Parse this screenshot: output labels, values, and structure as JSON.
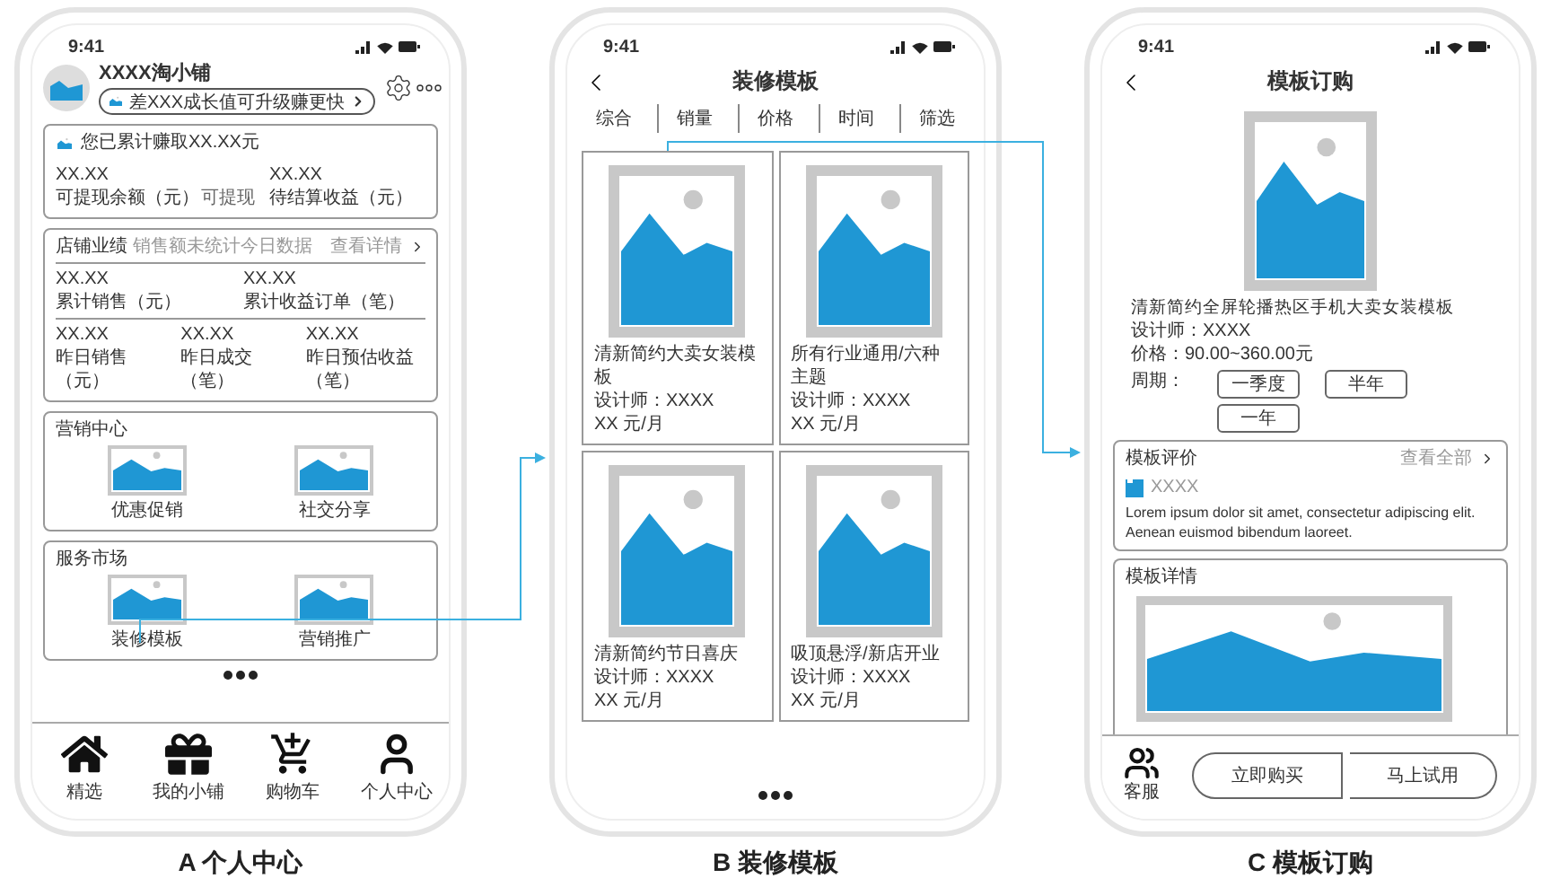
{
  "phones": [
    {
      "kind": "profile",
      "caption": "A 个人中心",
      "time": "9:41",
      "shop_name": "XXXX淘小铺",
      "upgrade_hint": "差XXX成长值可升级赚更快",
      "earnings": {
        "title": "您已累计赚取XX.XX元",
        "items": [
          {
            "value": "XX.XX",
            "label": "可提现余额（元）",
            "note": "可提现"
          },
          {
            "value": "XX.XX",
            "label": "待结算收益（元）"
          }
        ]
      },
      "performance": {
        "title": "店铺业绩",
        "subtitle": "销售额未统计今日数据",
        "link": "查看详情",
        "rows": [
          [
            {
              "value": "XX.XX",
              "label": "累计销售（元）"
            },
            {
              "value": "XX.XX",
              "label": "累计收益订单（笔）"
            }
          ],
          [
            {
              "value": "XX.XX",
              "label": "昨日销售（元）"
            },
            {
              "value": "XX.XX",
              "label": "昨日成交（笔）"
            },
            {
              "value": "XX.XX",
              "label": "昨日预估收益（笔）"
            }
          ]
        ]
      },
      "sections": [
        {
          "title": "营销中心",
          "items": [
            "优惠促销",
            "社交分享"
          ]
        },
        {
          "title": "服务市场",
          "items": [
            "装修模板",
            "营销推广"
          ]
        }
      ],
      "tabs": [
        "精选",
        "我的小铺",
        "购物车",
        "个人中心"
      ]
    },
    {
      "kind": "catalog",
      "caption": "B 装修模板",
      "time": "9:41",
      "title": "装修模板",
      "filters": [
        "综合",
        "销量",
        "价格",
        "时间",
        "筛选"
      ],
      "products": [
        {
          "name": "清新简约大卖女装模板",
          "designer": "设计师：XXXX",
          "price": "XX 元/月"
        },
        {
          "name": "所有行业通用/六种主题",
          "designer": "设计师：XXXX",
          "price": "XX 元/月"
        },
        {
          "name": "清新简约节日喜庆",
          "designer": "设计师：XXXX",
          "price": "XX 元/月"
        },
        {
          "name": "吸顶悬浮/新店开业",
          "designer": "设计师：XXXX",
          "price": "XX 元/月"
        }
      ]
    },
    {
      "kind": "order",
      "caption": "C 模板订购",
      "time": "9:41",
      "title": "模板订购",
      "product": {
        "name": "清新简约全屏轮播热区手机大卖女装模板",
        "designer": "设计师：XXXX",
        "price": "价格：90.00~360.00元"
      },
      "period": {
        "label": "周期：",
        "options": [
          "一季度",
          "半年",
          "一年"
        ]
      },
      "reviews": {
        "title": "模板评价",
        "link": "查看全部",
        "user": "XXXX",
        "text": "Lorem ipsum dolor sit amet, consectetur adipiscing elit. Aenean euismod bibendum laoreet."
      },
      "details": {
        "title": "模板详情"
      },
      "service": "客服",
      "actions": [
        "立即购买",
        "马上试用"
      ]
    }
  ]
}
